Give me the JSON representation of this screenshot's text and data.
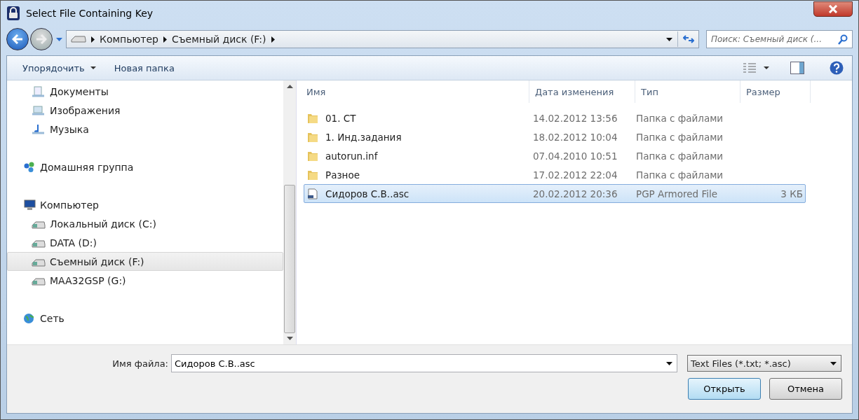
{
  "window": {
    "title": "Select File Containing Key"
  },
  "address": {
    "segments": [
      "Компьютер",
      "Съемный диск (F:)"
    ]
  },
  "search": {
    "placeholder": "Поиск: Съемный диск (..."
  },
  "toolbar": {
    "organize": "Упорядочить",
    "new_folder": "Новая папка"
  },
  "sidebar": {
    "sections": [
      {
        "children": [
          {
            "label": "Документы",
            "kind": "documents",
            "selected": false
          },
          {
            "label": "Изображения",
            "kind": "pictures",
            "selected": false
          },
          {
            "label": "Музыка",
            "kind": "music",
            "selected": false
          }
        ]
      },
      {
        "item": {
          "label": "Домашняя группа",
          "kind": "homegroup",
          "selected": false
        }
      },
      {
        "item": {
          "label": "Компьютер",
          "kind": "computer",
          "selected": false
        },
        "children": [
          {
            "label": "Локальный диск (C:)",
            "kind": "drive",
            "selected": false
          },
          {
            "label": "DATA (D:)",
            "kind": "drive",
            "selected": false
          },
          {
            "label": "Съемный диск (F:)",
            "kind": "drive",
            "selected": true
          },
          {
            "label": "MAA32GSP (G:)",
            "kind": "drive",
            "selected": false
          }
        ]
      },
      {
        "item": {
          "label": "Сеть",
          "kind": "network",
          "selected": false
        }
      }
    ]
  },
  "table": {
    "columns": [
      "Имя",
      "Дата изменения",
      "Тип",
      "Размер"
    ],
    "rows": [
      {
        "kind": "folder",
        "name": "01. СТ",
        "date": "14.02.2012 13:56",
        "type": "Папка с файлами",
        "selected": false
      },
      {
        "kind": "folder",
        "name": "1. Инд.задания",
        "date": "18.02.2012 10:04",
        "type": "Папка с файлами",
        "selected": false
      },
      {
        "kind": "folder",
        "name": "autorun.inf",
        "date": "07.04.2010 10:51",
        "type": "Папка с файлами",
        "selected": false
      },
      {
        "kind": "folder",
        "name": "Разное",
        "date": "17.02.2012 22:04",
        "type": "Папка с файлами",
        "selected": false
      },
      {
        "kind": "file",
        "name": "Сидоров С.В..asc",
        "date": "20.02.2012 20:36",
        "type": "PGP Armored File",
        "size": "3 КБ",
        "selected": true
      }
    ]
  },
  "footer": {
    "filename_label": "Имя файла:",
    "filename": "Сидоров С.В..asc",
    "filter": "Text Files (*.txt; *.asc)",
    "open": "Открыть",
    "cancel": "Отмена"
  }
}
